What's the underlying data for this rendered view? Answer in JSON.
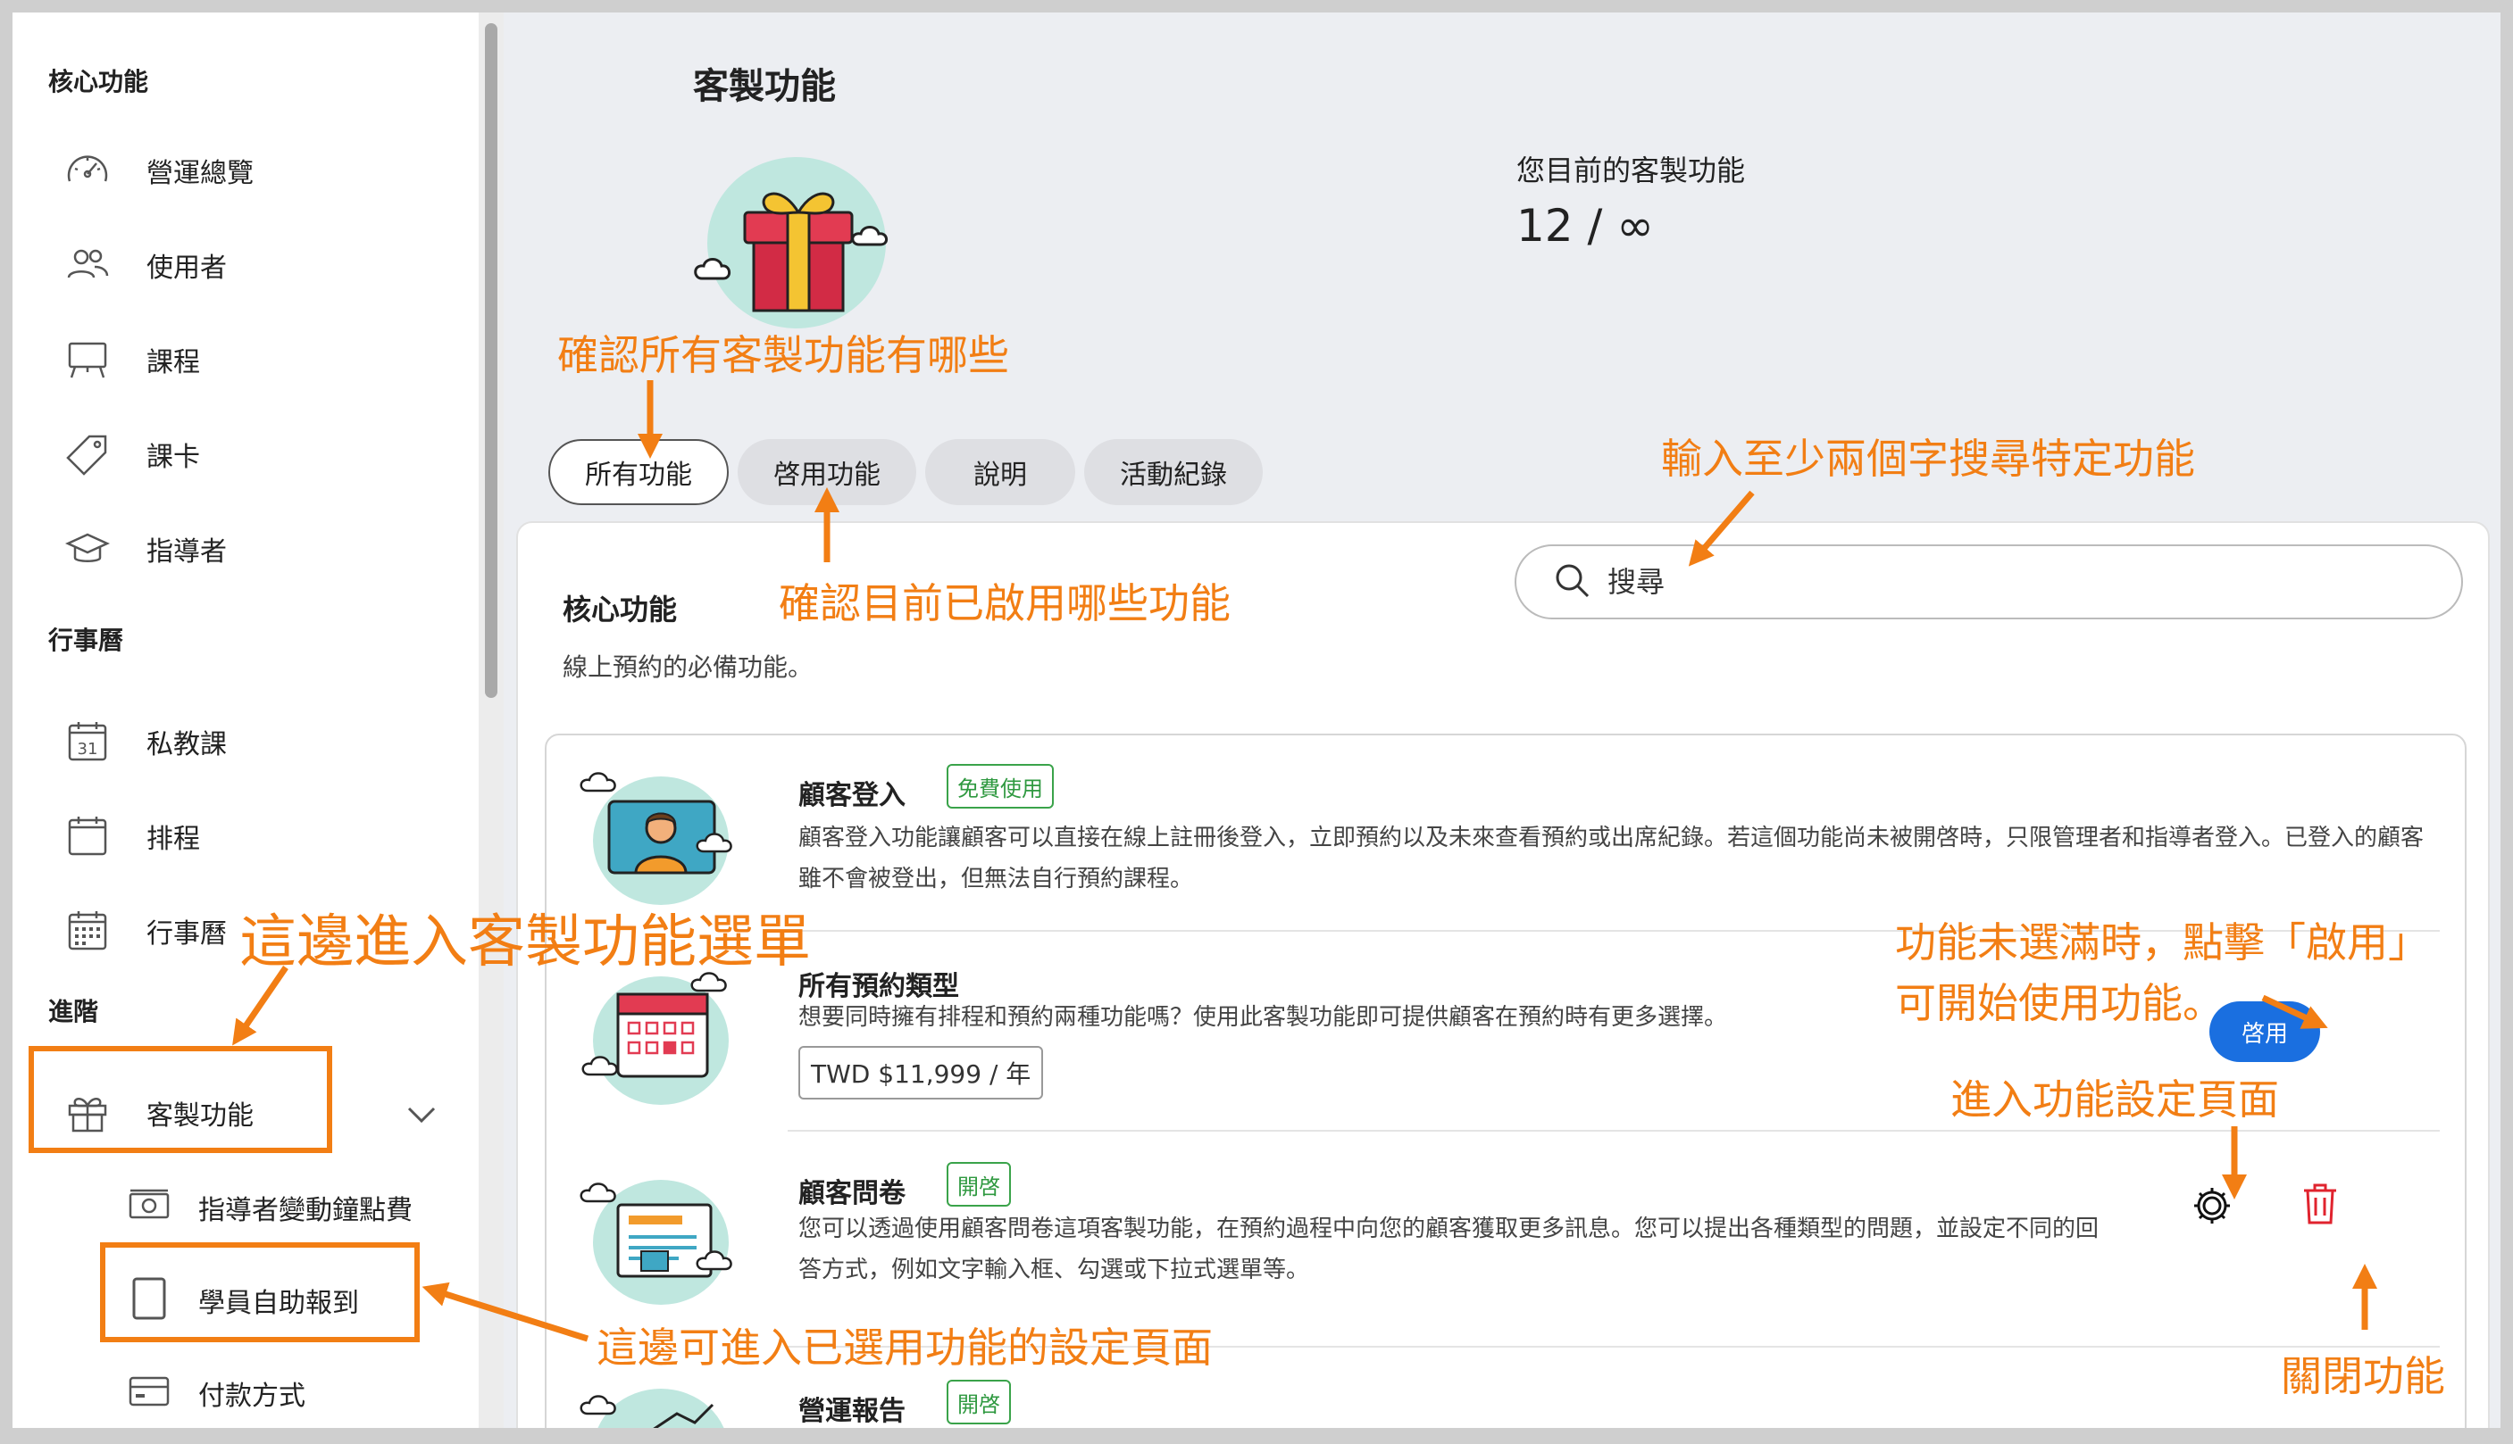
{
  "sidebar": {
    "sections": [
      "核心功能",
      "行事曆",
      "進階"
    ],
    "items": [
      {
        "label": "營運總覽",
        "icon": "dashboard-gauge-icon"
      },
      {
        "label": "使用者",
        "icon": "users-icon"
      },
      {
        "label": "課程",
        "icon": "presentation-board-icon"
      },
      {
        "label": "課卡",
        "icon": "tag-icon"
      },
      {
        "label": "指導者",
        "icon": "graduation-cap-icon"
      },
      {
        "label": "私教課",
        "icon": "calendar-31-icon"
      },
      {
        "label": "排程",
        "icon": "calendar-icon"
      },
      {
        "label": "行事曆",
        "icon": "calendar-grid-icon"
      },
      {
        "label": "客製功能",
        "icon": "gift-icon"
      }
    ],
    "sub_items": [
      {
        "label": "指導者變動鐘點費",
        "icon": "cash-icon"
      },
      {
        "label": "學員自助報到",
        "icon": "tablet-icon"
      },
      {
        "label": "付款方式",
        "icon": "credit-card-icon"
      }
    ]
  },
  "main": {
    "title": "客製功能",
    "quota_label": "您目前的客製功能",
    "quota_value": "12 / ∞",
    "tabs": [
      {
        "label": "所有功能"
      },
      {
        "label": "啓用功能"
      },
      {
        "label": "說明"
      },
      {
        "label": "活動紀錄"
      }
    ],
    "panel": {
      "title": "核心功能",
      "desc": "線上預約的必備功能。",
      "search_placeholder": "搜尋"
    },
    "features": [
      {
        "name": "顧客登入",
        "badge": "免費使用",
        "desc": "顧客登入功能讓顧客可以直接在線上註冊後登入，立即預約以及未來查看預約或出席紀錄。若這個功能尚未被開啓時，只限管理者和指導者登入。已登入的顧客雖不會被登出，但無法自行預約課程。"
      },
      {
        "name": "所有預約類型",
        "desc": "想要同時擁有排程和預約兩種功能嗎？使用此客製功能即可提供顧客在預約時有更多選擇。",
        "price": "TWD $11,999 / 年",
        "button": "啓用"
      },
      {
        "name": "顧客問卷",
        "badge": "開啓",
        "desc": "您可以透過使用顧客問卷這項客製功能，在預約過程中向您的顧客獲取更多訊息。您可以提出各種類型的問題，並設定不同的回答方式，例如文字輸入框、勾選或下拉式選單等。"
      },
      {
        "name": "營運報告",
        "badge": "開啓"
      }
    ]
  },
  "annotations": {
    "tabs_all": "確認所有客製功能有哪些",
    "tabs_enabled": "確認目前已啟用哪些功能",
    "search": "輸入至少兩個字搜尋特定功能",
    "menu": "這邊進入客製功能選單",
    "enable_line1": "功能未選滿時，點擊「啟用」",
    "enable_line2": "可開始使用功能。",
    "settings": "進入功能設定頁面",
    "submenu": "這邊可進入已選用功能的設定頁面",
    "disable": "關閉功能"
  },
  "colors": {
    "annotation": "#f27e14",
    "primary_button": "#1a6fe0",
    "badge_green": "#2f9940",
    "delete_red": "#e0232e"
  }
}
